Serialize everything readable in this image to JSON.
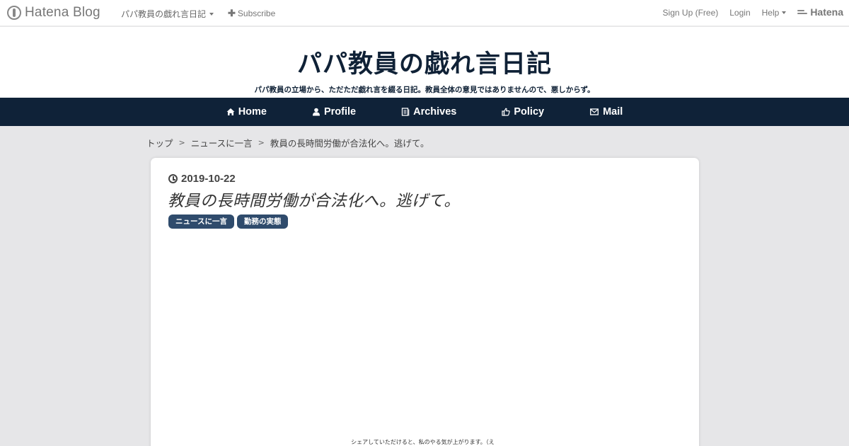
{
  "hatena_bar": {
    "logo_text": "Hatena Blog",
    "blog_name": "パパ教員の戯れ言日記",
    "subscribe_label": "Subscribe",
    "signup_label": "Sign Up (Free)",
    "login_label": "Login",
    "help_label": "Help",
    "hatena_label": "Hatena"
  },
  "header": {
    "title": "パパ教員の戯れ言日記",
    "description": "パパ教員の立場から、ただただ戯れ言を綴る日記。教員全体の意見ではありませんので、悪しからず。"
  },
  "nav": {
    "items": [
      {
        "label": "Home",
        "icon": "home-icon"
      },
      {
        "label": "Profile",
        "icon": "person-icon"
      },
      {
        "label": "Archives",
        "icon": "archive-icon"
      },
      {
        "label": "Policy",
        "icon": "thumbs-up-icon"
      },
      {
        "label": "Mail",
        "icon": "envelope-icon"
      }
    ]
  },
  "breadcrumb": {
    "items": [
      "トップ",
      "ニュースに一言",
      "教員の長時間労働が合法化へ。逃げて。"
    ],
    "separator": ">"
  },
  "article": {
    "date": "2019-10-22",
    "title": "教員の長時間労働が合法化へ。逃げて。",
    "categories": [
      "ニュースに一言",
      "勤務の実態"
    ],
    "share_note": "シェアしていただけると、私のやる気が上がります。（え"
  },
  "colors": {
    "nav_background": "#0f2238",
    "title_color": "#0f2136",
    "category_background": "#2f4b6c",
    "page_background": "#e6e6e8"
  }
}
